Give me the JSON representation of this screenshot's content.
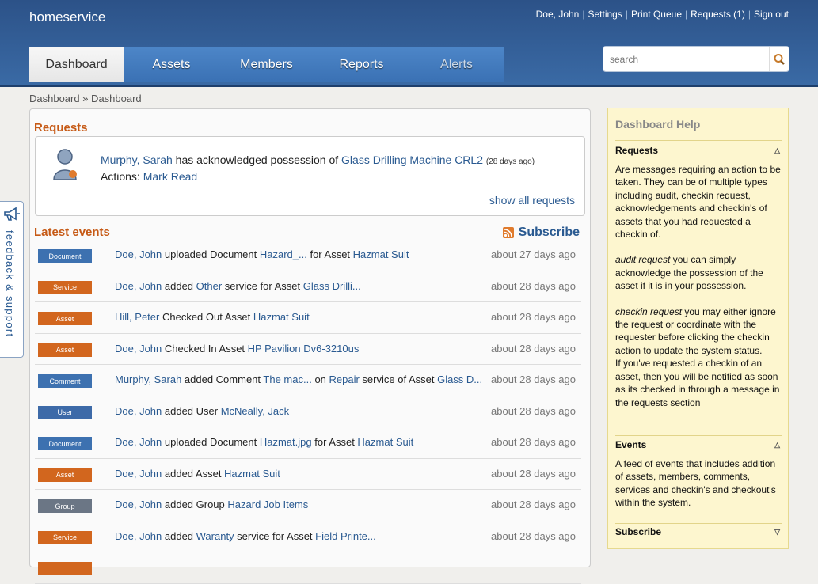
{
  "app": {
    "brand": "homeservice"
  },
  "toplinks": {
    "user": "Doe, John",
    "settings": "Settings",
    "print_queue": "Print Queue",
    "requests": "Requests (1)",
    "sign_out": "Sign out",
    "sep": "|"
  },
  "tabs": [
    {
      "label": "Dashboard"
    },
    {
      "label": "Assets"
    },
    {
      "label": "Members"
    },
    {
      "label": "Reports"
    },
    {
      "label": "Alerts"
    }
  ],
  "search": {
    "placeholder": "search"
  },
  "breadcrumb": "Dashboard » Dashboard",
  "requests": {
    "title": "Requests",
    "person": "Murphy, Sarah",
    "mid": " has acknowledged possession of ",
    "asset": "Glass Drilling Machine CRL2",
    "age": "(28 days ago)",
    "actions_label": "Actions: ",
    "action": "Mark Read",
    "show_all": "show all requests"
  },
  "events_title": "Latest events",
  "subscribe_label": "Subscribe",
  "events": [
    {
      "badge": "Document",
      "color": "#3d71b0",
      "parts": [
        [
          "l",
          "Doe, John"
        ],
        [
          "t",
          " uploaded Document "
        ],
        [
          "l",
          "Hazard_..."
        ],
        [
          "t",
          " for Asset "
        ],
        [
          "l",
          "Hazmat Suit"
        ]
      ],
      "time": "about 27 days ago"
    },
    {
      "badge": "Service",
      "color": "#d2661e",
      "parts": [
        [
          "l",
          "Doe, John"
        ],
        [
          "t",
          " added "
        ],
        [
          "l",
          "Other"
        ],
        [
          "t",
          " service for Asset "
        ],
        [
          "l",
          "Glass Drilli..."
        ]
      ],
      "time": "about 28 days ago"
    },
    {
      "badge": "Asset",
      "color": "#d2661e",
      "parts": [
        [
          "l",
          "Hill, Peter"
        ],
        [
          "t",
          " Checked Out Asset "
        ],
        [
          "l",
          "Hazmat Suit"
        ]
      ],
      "time": "about 28 days ago"
    },
    {
      "badge": "Asset",
      "color": "#d2661e",
      "parts": [
        [
          "l",
          "Doe, John"
        ],
        [
          "t",
          " Checked In Asset "
        ],
        [
          "l",
          "HP Pavilion Dv6-3210us"
        ]
      ],
      "time": "about 28 days ago"
    },
    {
      "badge": "Comment",
      "color": "#3d71b0",
      "parts": [
        [
          "l",
          "Murphy, Sarah"
        ],
        [
          "t",
          " added Comment "
        ],
        [
          "l",
          "The mac..."
        ],
        [
          "t",
          " on "
        ],
        [
          "l",
          "Repair"
        ],
        [
          "t",
          " service of Asset "
        ],
        [
          "l",
          "Glass D..."
        ]
      ],
      "time": "about 28 days ago"
    },
    {
      "badge": "User",
      "color": "#3d6aa8",
      "parts": [
        [
          "l",
          "Doe, John"
        ],
        [
          "t",
          " added User "
        ],
        [
          "l",
          "McNeally, Jack"
        ]
      ],
      "time": "about 28 days ago"
    },
    {
      "badge": "Document",
      "color": "#3d71b0",
      "parts": [
        [
          "l",
          "Doe, John"
        ],
        [
          "t",
          " uploaded Document "
        ],
        [
          "l",
          "Hazmat.jpg"
        ],
        [
          "t",
          " for Asset "
        ],
        [
          "l",
          "Hazmat Suit"
        ]
      ],
      "time": "about 28 days ago"
    },
    {
      "badge": "Asset",
      "color": "#d2661e",
      "parts": [
        [
          "l",
          "Doe, John"
        ],
        [
          "t",
          " added Asset "
        ],
        [
          "l",
          "Hazmat Suit"
        ]
      ],
      "time": "about 28 days ago"
    },
    {
      "badge": "Group",
      "color": "#6b7685",
      "parts": [
        [
          "l",
          "Doe, John"
        ],
        [
          "t",
          " added Group "
        ],
        [
          "l",
          "Hazard Job Items"
        ]
      ],
      "time": "about 28 days ago"
    },
    {
      "badge": "Service",
      "color": "#d2661e",
      "parts": [
        [
          "l",
          "Doe, John"
        ],
        [
          "t",
          " added "
        ],
        [
          "l",
          "Waranty"
        ],
        [
          "t",
          " service for Asset "
        ],
        [
          "l",
          "Field Printe..."
        ]
      ],
      "time": "about 28 days ago"
    },
    {
      "badge": "",
      "color": "#d2661e",
      "parts": [],
      "time": ""
    }
  ],
  "help": {
    "title": "Dashboard Help",
    "requests_heading": "Requests",
    "requests_p1": "Are messages requiring an action to be taken. They can be of multiple types including audit, checkin request, acknowledgements and checkin's of assets that you had requested a checkin of.",
    "audit_em": "audit request",
    "audit_rest": " you can simply acknowledge the possession of the asset if it is in your possession.",
    "checkin_em": "checkin request",
    "checkin_rest": " you may either ignore the request or coordinate with the requester before clicking the checkin action to update the system status.",
    "checkin_p2": "If you've requested a checkin of an asset, then you will be notified as soon as its checked in through a message in the requests section",
    "events_heading": "Events",
    "events_text": "A feed of events that includes addition of assets, members, comments, services and checkin's and checkout's within the system.",
    "subscribe_heading": "Subscribe"
  },
  "feedback": {
    "label": "feedback & support"
  }
}
